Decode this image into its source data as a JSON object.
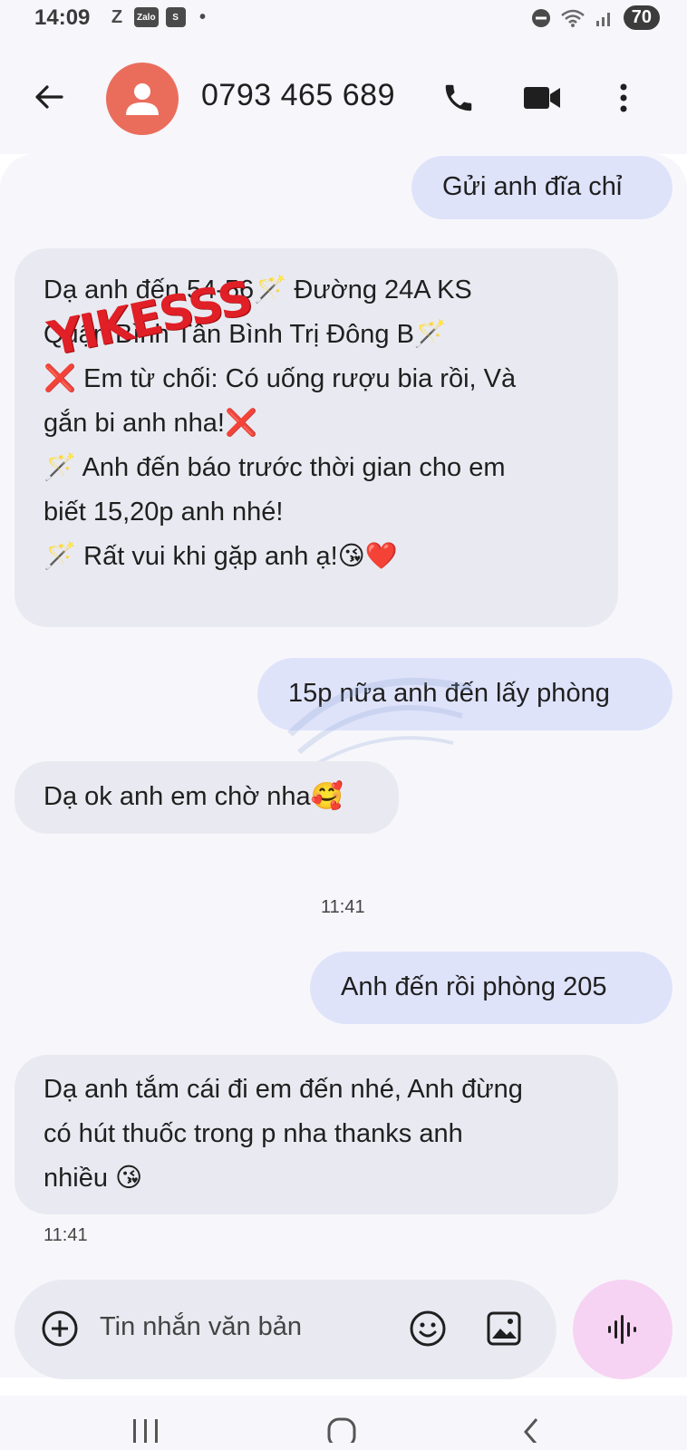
{
  "status_bar": {
    "time": "14:09",
    "left_icons": [
      "Z",
      "Zalo",
      "S",
      "•"
    ],
    "battery": "70"
  },
  "header": {
    "contact": "0793 465 689"
  },
  "messages": [
    {
      "direction": "out",
      "lines": [
        "Gửi anh đĩa chỉ"
      ]
    },
    {
      "direction": "in",
      "lines": [
        "Dạ anh đến 54-56🪄 Đường 24A KS",
        "Quận Bình Tân Bình Trị Đông B🪄",
        "❌ Em từ chối: Có uống rượu bia rồi, Và",
        "gắn bi anh nha!❌",
        "🪄 Anh đến báo trước thời gian cho em",
        "biết 15,20p anh nhé!",
        "🪄  Rất vui khi gặp anh ạ!😘❤️"
      ]
    },
    {
      "direction": "out",
      "lines": [
        "15p nữa anh đến lấy phòng"
      ]
    },
    {
      "direction": "in",
      "lines": [
        "Dạ ok anh em chờ nha🥰"
      ]
    },
    {
      "direction": "out",
      "lines": [
        "Anh đến rồi phòng 205"
      ]
    },
    {
      "direction": "in",
      "lines": [
        "Dạ anh tắm cái đi em đến nhé, Anh đừng",
        "có hút thuốc trong p nha thanks anh",
        "nhiều 😘"
      ]
    }
  ],
  "timestamps": {
    "divider": "11:41",
    "last_message": "11:41"
  },
  "overlay": {
    "sticker_text": "YIKESSS"
  },
  "composer": {
    "placeholder": "Tin nhắn văn bản"
  },
  "icons": {
    "back": "back-arrow-icon",
    "avatar": "person-icon",
    "call": "phone-icon",
    "video": "video-camera-icon",
    "menu": "more-vertical-icon",
    "add": "add-circle-icon",
    "emoji": "emoji-icon",
    "gallery": "gallery-icon",
    "voice": "voice-waveform-icon"
  },
  "colors": {
    "outgoing_bubble": "#dfe3fa",
    "incoming_bubble": "#e9eaf1",
    "avatar": "#ea6d5c",
    "voice_button": "#f7d3f3",
    "sticker": "#e01f26"
  }
}
